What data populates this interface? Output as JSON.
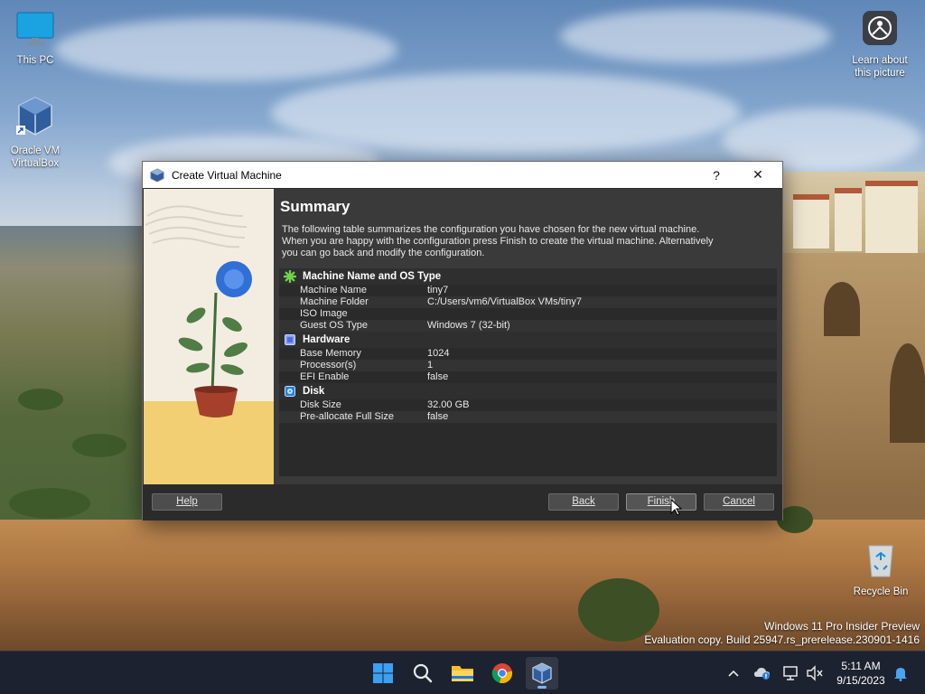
{
  "desktop": {
    "icons": [
      {
        "label": "This PC"
      },
      {
        "label": "Oracle VM VirtualBox"
      },
      {
        "label": "Learn about this picture"
      },
      {
        "label": "Recycle Bin"
      }
    ],
    "watermark": {
      "line1": "Windows 11 Pro Insider Preview",
      "line2": "Evaluation copy. Build 25947.rs_prerelease.230901-1416"
    }
  },
  "dialog": {
    "title": "Create Virtual Machine",
    "help_symbol": "?",
    "close_symbol": "✕",
    "heading": "Summary",
    "description": [
      "The following table summarizes the configuration you have chosen for the new virtual machine.",
      "When you are happy with the configuration press Finish to create the virtual machine. Alternatively",
      "you can go back and modify the configuration."
    ],
    "sections": [
      {
        "title": "Machine Name and OS Type",
        "icon": "green-star-icon",
        "rows": [
          {
            "key": "Machine Name",
            "value": "tiny7"
          },
          {
            "key": "Machine Folder",
            "value": "C:/Users/vm6/VirtualBox VMs/tiny7"
          },
          {
            "key": "ISO Image",
            "value": ""
          },
          {
            "key": "Guest OS Type",
            "value": "Windows 7 (32-bit)"
          }
        ]
      },
      {
        "title": "Hardware",
        "icon": "chip-icon",
        "rows": [
          {
            "key": "Base Memory",
            "value": "1024"
          },
          {
            "key": "Processor(s)",
            "value": "1"
          },
          {
            "key": "EFI Enable",
            "value": "false"
          }
        ]
      },
      {
        "title": "Disk",
        "icon": "disk-icon",
        "rows": [
          {
            "key": "Disk Size",
            "value": "32.00 GB"
          },
          {
            "key": "Pre-allocate Full Size",
            "value": "false"
          }
        ]
      }
    ],
    "buttons": {
      "help": "Help",
      "back": "Back",
      "finish": "Finish",
      "cancel": "Cancel"
    }
  },
  "taskbar": {
    "apps": [
      "start-icon",
      "search-icon",
      "file-explorer-icon",
      "chrome-icon",
      "virtualbox-icon"
    ],
    "tray": [
      "chevron-up-icon",
      "onedrive-icon",
      "network-icon",
      "volume-muted-icon",
      "notification-bell-icon"
    ],
    "time": "5:11 AM",
    "date": "9/15/2023"
  },
  "colors": {
    "dialog_bg": "#3a3a3a",
    "taskbar_bg": "#1d2230",
    "accent": "#7fb3ff"
  }
}
